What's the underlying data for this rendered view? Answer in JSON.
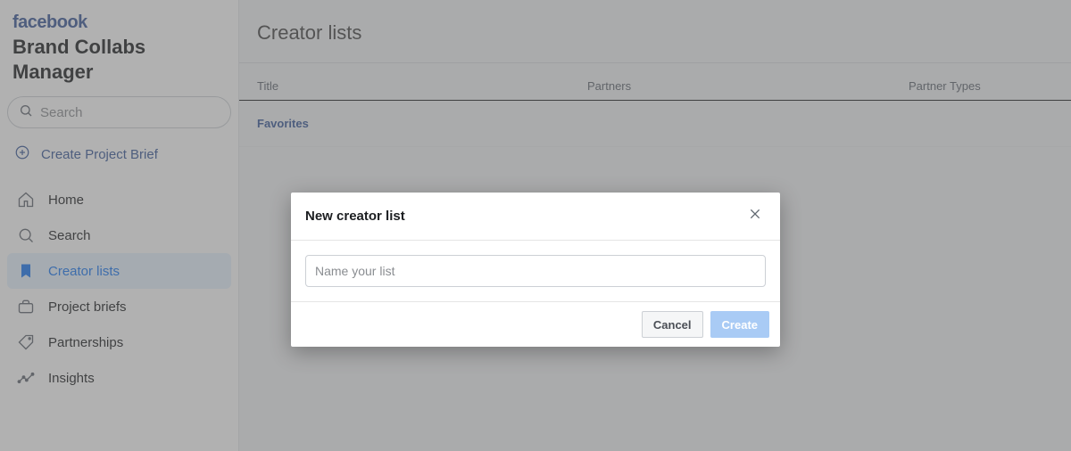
{
  "brand": {
    "logo_text": "facebook",
    "app_title": "Brand Collabs Manager"
  },
  "sidebar": {
    "search_placeholder": "Search",
    "create_brief_label": "Create Project Brief",
    "nav": [
      {
        "label": "Home"
      },
      {
        "label": "Search"
      },
      {
        "label": "Creator lists"
      },
      {
        "label": "Project briefs"
      },
      {
        "label": "Partnerships"
      },
      {
        "label": "Insights"
      }
    ]
  },
  "main": {
    "title": "Creator lists",
    "columns": {
      "title": "Title",
      "partners": "Partners",
      "types": "Partner Types"
    },
    "rows": [
      {
        "title": "Favorites",
        "partners": "",
        "types": ""
      }
    ]
  },
  "modal": {
    "title": "New creator list",
    "input_placeholder": "Name your list",
    "cancel_label": "Cancel",
    "create_label": "Create"
  }
}
